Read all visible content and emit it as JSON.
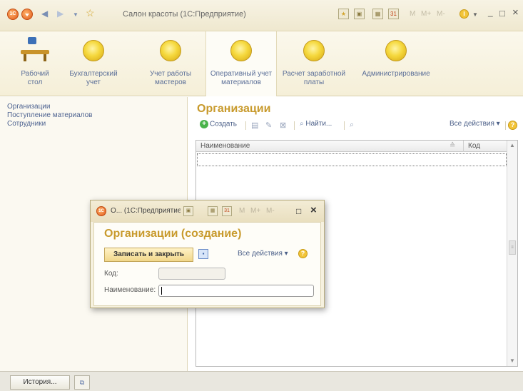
{
  "titlebar": {
    "logo_text": "1C",
    "title": "Салон красоты (1С:Предприятие)",
    "nav_back": "◀",
    "nav_forward": "▶",
    "nav_dropdown": "▼",
    "favorite": "☆",
    "tools": [
      "M",
      "M+",
      "M-"
    ],
    "info": "i",
    "minimize": "_",
    "maximize": "□",
    "close": "×"
  },
  "sections": [
    {
      "label": "Рабочий стол",
      "icon": "desk-icon"
    },
    {
      "label": "Бухгалтерский учет",
      "icon": "coin-icon"
    },
    {
      "label": "Учет работы мастеров",
      "icon": "coin-icon"
    },
    {
      "label": "Оперативный учет материалов",
      "icon": "coin-icon",
      "active": true
    },
    {
      "label": "Расчет заработной платы",
      "icon": "coin-icon"
    },
    {
      "label": "Администрирование",
      "icon": "coin-icon"
    }
  ],
  "nav_panel": {
    "items": [
      "Организации",
      "Поступление материалов",
      "Сотрудники"
    ]
  },
  "list_form": {
    "title": "Организации",
    "create_label": "Создать",
    "find_label": "Найти...",
    "all_actions_label": "Все действия ▾",
    "help": "?",
    "columns": [
      "Наименование",
      "Код"
    ],
    "sort_indicator": "≙",
    "rows": []
  },
  "dialog": {
    "logo_text": "1C",
    "window_title": "О... (1С:Предприятие)",
    "tools": [
      "M",
      "M+",
      "M-"
    ],
    "maximize": "□",
    "close": "×",
    "form_title": "Организации (создание)",
    "save_close_label": "Записать и закрыть",
    "all_actions_label": "Все действия ▾",
    "help": "?",
    "fields": {
      "code_label": "Код:",
      "code_value": "",
      "name_label": "Наименование:",
      "name_value": ""
    }
  },
  "bottom": {
    "history_label": "История...",
    "windows_icon": "⧉"
  },
  "colors": {
    "accent_title": "#c89a2c",
    "link_blue": "#4f6491",
    "panel_bg": "#fbf9f1",
    "header_bg": "#f5efd8"
  }
}
